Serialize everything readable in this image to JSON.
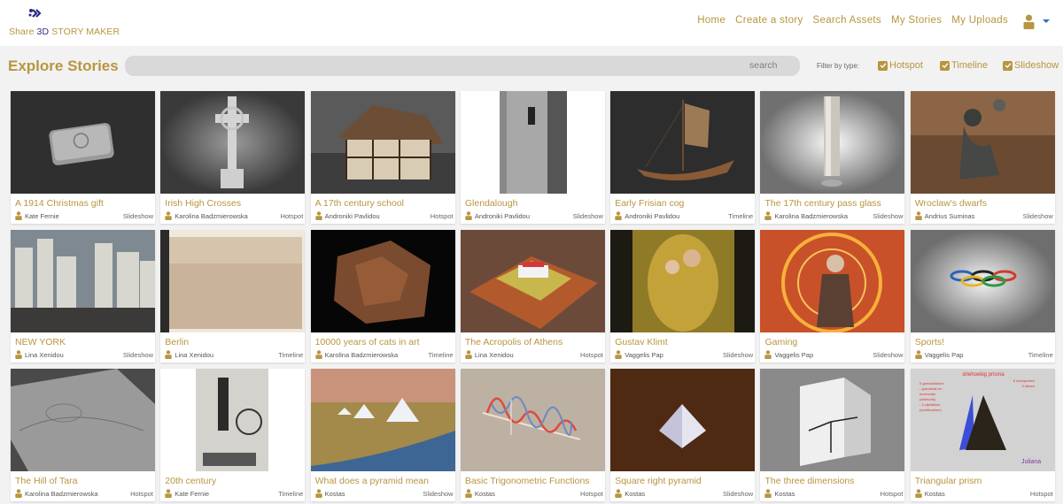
{
  "app": {
    "logo": {
      "part1": "Share ",
      "part2": "3D",
      "part3": " STORY MAKER"
    },
    "nav": [
      {
        "label": "Home"
      },
      {
        "label": "Create a story"
      },
      {
        "label": "Search Assets"
      },
      {
        "label": "My Stories"
      },
      {
        "label": "My Uploads"
      }
    ],
    "user_icon": "user-icon",
    "accent_color": "#b8953f",
    "brand_blue": "#2c2a86"
  },
  "explore": {
    "title": "Explore Stories",
    "search": {
      "value": "",
      "button_label": "search"
    },
    "filter_label": "Filter by type:",
    "filters": [
      {
        "label": "Hotspot",
        "checked": true
      },
      {
        "label": "Timeline",
        "checked": true
      },
      {
        "label": "Slideshow",
        "checked": true
      }
    ]
  },
  "stories": [
    {
      "title": "A 1914 Christmas gift",
      "author": "Kate Fernie",
      "type": "Slideshow",
      "thumb": "tin-box"
    },
    {
      "title": "Irish High Crosses",
      "author": "Karolina Badzmierowska",
      "type": "Hotspot",
      "thumb": "celtic-cross"
    },
    {
      "title": "A 17th century school",
      "author": "Androniki Pavlidou",
      "type": "Hotspot",
      "thumb": "timber-house"
    },
    {
      "title": "Glendalough",
      "author": "Androniki Pavlidou",
      "type": "Slideshow",
      "thumb": "round-tower"
    },
    {
      "title": "Early Frisian cog",
      "author": "Androniki Pavlidou",
      "type": "Timeline",
      "thumb": "ship"
    },
    {
      "title": "The 17th century pass glass",
      "author": "Karolina Badzmierowska",
      "type": "Slideshow",
      "thumb": "glass"
    },
    {
      "title": "Wroclaw's dwarfs",
      "author": "Andrius Suminas",
      "type": "Slideshow",
      "thumb": "dwarf-statue"
    },
    {
      "title": "NEW YORK",
      "author": "Lina Xenidou",
      "type": "Slideshow",
      "thumb": "city"
    },
    {
      "title": "Berlin",
      "author": "Lina Xenidou",
      "type": "Timeline",
      "thumb": "old-map"
    },
    {
      "title": "10000 years of cats in art",
      "author": "Karolina Badzmierowska",
      "type": "Timeline",
      "thumb": "stone-relief"
    },
    {
      "title": "The Acropolis of Athens",
      "author": "Lina Xenidou",
      "type": "Hotspot",
      "thumb": "acropolis"
    },
    {
      "title": "Gustav Klimt",
      "author": "Vaggelis Pap",
      "type": "Slideshow",
      "thumb": "klimt-painting"
    },
    {
      "title": "Gaming",
      "author": "Vaggelis Pap",
      "type": "Slideshow",
      "thumb": "game-character"
    },
    {
      "title": "Sports!",
      "author": "Vaggelis Pap",
      "type": "Timeline",
      "thumb": "olympic-rings"
    },
    {
      "title": "The Hill of Tara",
      "author": "Karolina Badzmierowska",
      "type": "Hotspot",
      "thumb": "terrain"
    },
    {
      "title": "20th century",
      "author": "Kate Fernie",
      "type": "Timeline",
      "thumb": "old-photo"
    },
    {
      "title": "What does a pyramid mean",
      "author": "Kostas",
      "type": "Slideshow",
      "thumb": "pyramids"
    },
    {
      "title": "Basic Trigonometric Functions",
      "author": "Kostas",
      "type": "Hotspot",
      "thumb": "sine-waves"
    },
    {
      "title": "Square right pyramid",
      "author": "Kostas",
      "type": "Slideshow",
      "thumb": "pyramid-shape"
    },
    {
      "title": "The three dimensions",
      "author": "Kostas",
      "type": "Hotspot",
      "thumb": "3d-axes"
    },
    {
      "title": "Triangular prism",
      "author": "Kostas",
      "type": "Hotspot",
      "thumb": "prism",
      "thumb_text": {
        "heading": "driehoekig prisma",
        "left": [
          "5 grensvlakken:",
          "- grondvlak en",
          "bovenvlak",
          "(driehoek)",
          "- 3 zijvlakken",
          "(rechthoeken)"
        ],
        "right": [
          "6 hoekpunten",
          "9 ribben"
        ],
        "signature": "Juliana"
      }
    }
  ]
}
